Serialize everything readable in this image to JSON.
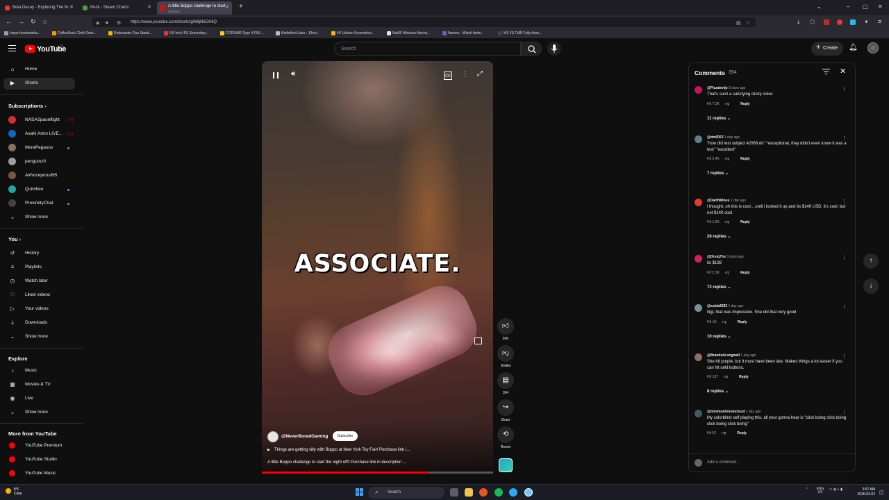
{
  "browser": {
    "tabs": [
      {
        "title": "Beta Decay - Exploring The M...",
        "sub": ""
      },
      {
        "title": "Puck - Steam Charts",
        "sub": ""
      },
      {
        "title": "A little Boppo challenge to start",
        "sub": "PLAYING"
      }
    ],
    "url": "https://www.youtube.com/shorts/gW6jN6OHliQ",
    "bookmarks": [
      "Import bookmarks...",
      "CoffeeSock Cloth Desk...",
      "Rodecaster Duo Stand...",
      "8.8 Inch IPS Secondary...",
      "CORSAIR Type 4 PSU ...",
      "Battlefield Labs – Elect...",
      "4V Lithium Screwdrive...",
      "Nut65 Wireless Mecha...",
      "9anime - Watch Anim...",
      "M1 VS TMR Fully Asse..."
    ]
  },
  "header": {
    "logo": "YouTube",
    "country": "CA",
    "search_placeholder": "Search",
    "create_label": "Create"
  },
  "sidebar": {
    "main": [
      {
        "label": "Home",
        "icon": "home-icon",
        "glyph": "⌂"
      },
      {
        "label": "Shorts",
        "icon": "shorts-icon",
        "glyph": "▶"
      }
    ],
    "subscriptions_title": "Subscriptions",
    "subscriptions": [
      {
        "label": "NASASpaceflight",
        "color": "#d32f2f",
        "badge": "live"
      },
      {
        "label": "Asahi Astro LIVE...",
        "color": "#1565c0",
        "badge": "live"
      },
      {
        "label": "MorePegasus",
        "color": "#8d6e63",
        "badge": "dot"
      },
      {
        "label": "penguinz0",
        "color": "#9e9e9e",
        "badge": "none"
      },
      {
        "label": "Airforceproud95",
        "color": "#795548",
        "badge": "none"
      },
      {
        "label": "Quintheo",
        "color": "#26a69a",
        "badge": "dot"
      },
      {
        "label": "ProximityChat",
        "color": "#424242",
        "badge": "dot"
      }
    ],
    "show_more": "Show more",
    "you_title": "You",
    "you": [
      {
        "label": "History",
        "glyph": "↺"
      },
      {
        "label": "Playlists",
        "glyph": "≡"
      },
      {
        "label": "Watch later",
        "glyph": "◷"
      },
      {
        "label": "Liked videos",
        "glyph": "♡"
      },
      {
        "label": "Your videos",
        "glyph": "▷"
      },
      {
        "label": "Downloads",
        "glyph": "⤓"
      }
    ],
    "explore_title": "Explore",
    "explore": [
      {
        "label": "Music",
        "glyph": "♪"
      },
      {
        "label": "Movies & TV",
        "glyph": "▦"
      },
      {
        "label": "Live",
        "glyph": "◉"
      }
    ],
    "more_title": "More from YouTube",
    "more": [
      {
        "label": "YouTube Premium"
      },
      {
        "label": "YouTube Studio"
      },
      {
        "label": "YouTube Music"
      }
    ]
  },
  "video": {
    "overlay_text": "ASSOCIATE.",
    "channel": "@NeverBoredGaming",
    "subscribe": "Subscribe",
    "link_text": "Things are getting silly with Boppo at New York Toy Fair! Purchase link i...",
    "description": "A little Boppo challenge to start the night off!! Purchase link in description ...",
    "progress": 0.72
  },
  "actions": {
    "likes": "26K",
    "dislike": "Dislike",
    "comments": "394",
    "share": "Share",
    "remix": "Remix"
  },
  "comments": {
    "title": "Comments",
    "count": "394",
    "add_placeholder": "Add a comment...",
    "reply_label": "Reply",
    "items": [
      {
        "user": "@Pizzatertje",
        "date": "3 days ago",
        "text": "That's such a satisfying clicky noise",
        "likes": "7.3K",
        "replies": "11 replies",
        "color": "#c2185b"
      },
      {
        "user": "@dm6053",
        "date": "1 day ago",
        "text": "\"how did test subject 42069 do\" \"exceptional, they didn't even know it was a  test\" \"excellent\"",
        "likes": "5.4K",
        "replies": "7 replies",
        "color": "#607d8b"
      },
      {
        "user": "@DarthMinos",
        "date": "1 day ago",
        "text": "i thought, oh this is cool... until i looked it up and its $140 USD.  it's cool. but not $140 cool",
        "likes": "1.5K",
        "replies": "26 replies",
        "color": "#e53935"
      },
      {
        "user": "@Dt-oq7ho",
        "date": "3 days ago",
        "text": "its $139",
        "likes": "2.3K",
        "replies": "72 replies",
        "color": "#d81b60"
      },
      {
        "user": "@xubia3593",
        "date": "1 day ago",
        "text": "Ngl, that was impressive. She did that very good",
        "likes": "1K",
        "replies": "10 replies",
        "color": "#78909c"
      },
      {
        "user": "@BrandonLongwell",
        "date": "1 day ago",
        "text": "She hit purple, but it must have been late. Makes things a lot easier if you can hit unlit buttons.",
        "likes": "157",
        "replies": "8 replies",
        "color": "#8d6e63"
      },
      {
        "user": "@minimushroomcloud",
        "date": "1 day ago",
        "text": "My colorblind self playing this, all your gonna hear is \"click boing click boing click boing click boing\"",
        "likes": "52",
        "replies": "",
        "color": "#455a64"
      }
    ]
  },
  "taskbar": {
    "temp": "8°F",
    "weather": "Clear",
    "search": "Search",
    "lang": "ENG",
    "region": "US",
    "time": "3:57 AM",
    "date": "2026-03-02"
  },
  "colors": {
    "accent": "#ff0000",
    "background": "#0f0f0f",
    "link_blue": "#3ea6ff"
  }
}
